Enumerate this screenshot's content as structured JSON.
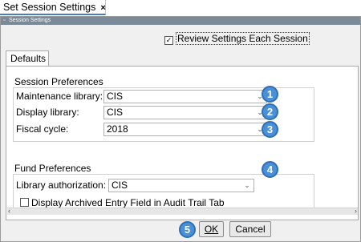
{
  "tab": {
    "title": "Set Session Settings",
    "close_glyph": "×"
  },
  "dialog": {
    "title": "Session Settings"
  },
  "review": {
    "checked": true,
    "label": "Review Settings Each Session"
  },
  "subtab": {
    "label": "Defaults"
  },
  "session_prefs": {
    "title": "Session Preferences",
    "fields": [
      {
        "label": "Maintenance library:",
        "value": "CIS",
        "badge": "1"
      },
      {
        "label": "Display library:",
        "value": "CIS",
        "badge": "2"
      },
      {
        "label": "Fiscal cycle:",
        "value": "2018",
        "badge": "3"
      }
    ]
  },
  "fund_prefs": {
    "title": "Fund Preferences",
    "library_auth": {
      "label": "Library authorization:",
      "value": "CIS",
      "badge": "4"
    },
    "archived": {
      "checked": false,
      "label": "Display Archived Entry Field in Audit Trail Tab"
    }
  },
  "buttons": {
    "ok_badge": "5",
    "ok_label": "OK",
    "cancel_label": "Cancel"
  },
  "icons": {
    "dropdown": "chevron-down-icon",
    "scroll_left": "arrow-left-icon",
    "scroll_right": "arrow-right-icon"
  },
  "colors": {
    "badge": "#4a90d9",
    "titlebar": "#7a8a99"
  }
}
